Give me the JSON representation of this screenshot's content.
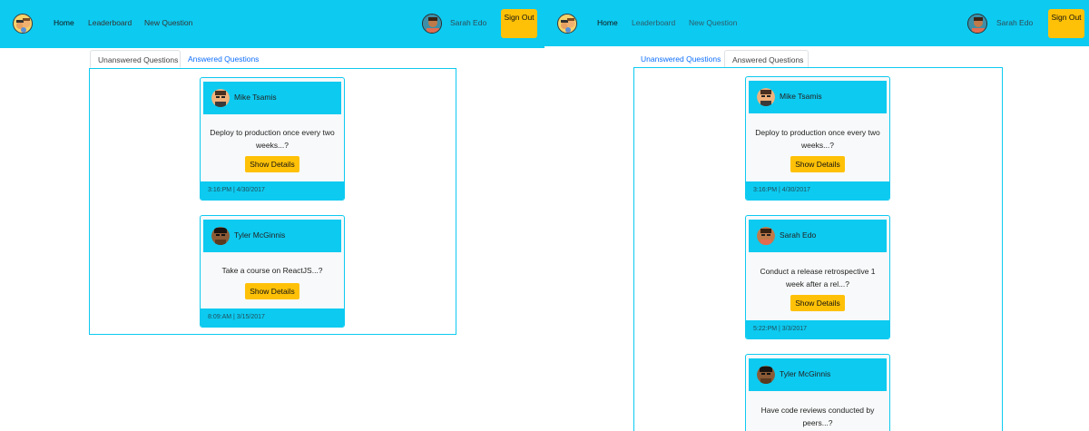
{
  "colors": {
    "navbar": "#0dcaf0",
    "accent_button": "#ffc107",
    "link": "#0d6efd",
    "card_body": "#f8f9fa"
  },
  "app": {
    "logo_icon": "app-logo-icon"
  },
  "nav": {
    "home": "Home",
    "leaderboard": "Leaderboard",
    "new_question": "New Question",
    "user_name": "Sarah Edo",
    "sign_out": "Sign Out"
  },
  "left_view": {
    "tabs": [
      "Unanswered Questions",
      "Answered Questions"
    ],
    "selected_tab": "Unanswered Questions",
    "questions": [
      {
        "author": "Mike Tsamis",
        "text": "Deploy to production once every two weeks...?",
        "button": "Show Details",
        "timestamp": "3:16:PM | 4/30/2017"
      },
      {
        "author": "Tyler McGinnis",
        "text": "Take a course on ReactJS...?",
        "button": "Show Details",
        "timestamp": "8:09:AM | 3/15/2017"
      }
    ]
  },
  "right_view": {
    "tabs": [
      "Unanswered Questions",
      "Answered Questions"
    ],
    "selected_tab": "Answered Questions",
    "questions": [
      {
        "author": "Mike Tsamis",
        "text": "Deploy to production once every two weeks...?",
        "button": "Show Details",
        "timestamp": "3:16:PM | 4/30/2017"
      },
      {
        "author": "Sarah Edo",
        "text": "Conduct a release retrospective 1 week after a rel...?",
        "button": "Show Details",
        "timestamp": "5:22:PM | 3/3/2017"
      },
      {
        "author": "Tyler McGinnis",
        "text": "Have code reviews conducted by peers...?",
        "button": "",
        "timestamp": ""
      }
    ]
  }
}
